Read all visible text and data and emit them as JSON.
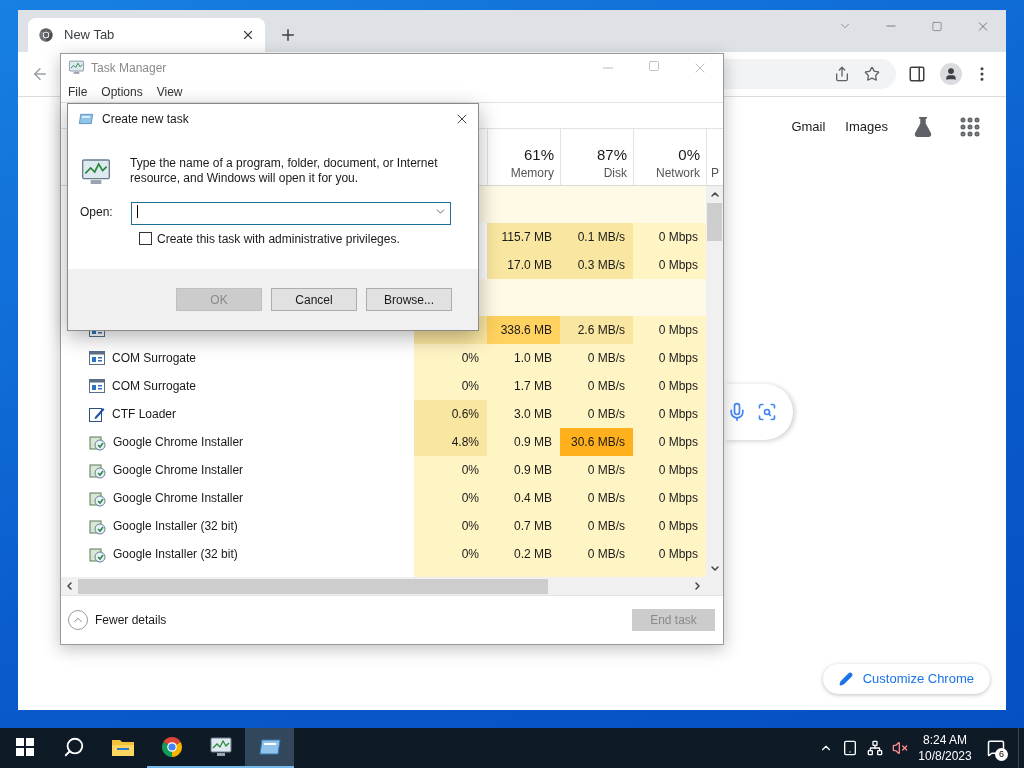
{
  "chrome": {
    "tabs": [
      {
        "title": "New Tab",
        "selected": true
      }
    ],
    "header_links": [
      "Gmail",
      "Images"
    ],
    "customize_button": "Customize Chrome"
  },
  "task_manager": {
    "title": "Task Manager",
    "menu": [
      "File",
      "Options",
      "View"
    ],
    "columns": [
      {
        "percent": "61%",
        "label": "Memory"
      },
      {
        "percent": "87%",
        "label": "Disk"
      },
      {
        "percent": "0%",
        "label": "Network"
      },
      {
        "label": "P"
      }
    ],
    "rows": [
      {
        "kind": "group"
      },
      {
        "kind": "hidden",
        "cells": [
          null,
          {
            "text": "115.7 MB",
            "color": "#f9e6a0"
          },
          {
            "text": "0.1 MB/s",
            "color": "#f9e6a0"
          },
          {
            "text": "0 Mbps",
            "color": "#fff4c4"
          }
        ]
      },
      {
        "kind": "hidden",
        "cells": [
          null,
          {
            "text": "17.0 MB",
            "color": "#f9e6a0"
          },
          {
            "text": "0.3 MB/s",
            "color": "#f9e6a0"
          },
          {
            "text": "0 Mbps",
            "color": "#fff4c4"
          }
        ]
      },
      {
        "kind": "group"
      },
      {
        "kind": "service",
        "cells": [
          {
            "color": "#f9e6a0"
          },
          {
            "text": "338.6 MB",
            "color": "#ffd15e"
          },
          {
            "text": "2.6 MB/s",
            "color": "#f9e6a0"
          },
          {
            "text": "0 Mbps",
            "color": "#fff4c4"
          }
        ]
      },
      {
        "kind": "service",
        "name": "COM Surrogate",
        "cells": [
          {
            "text": "0%",
            "color": "#fff4c4"
          },
          {
            "text": "1.0 MB",
            "color": "#fff4c4"
          },
          {
            "text": "0 MB/s",
            "color": "#fff4c4"
          },
          {
            "text": "0 Mbps",
            "color": "#fff4c4"
          }
        ]
      },
      {
        "kind": "service",
        "name": "COM Surrogate",
        "cells": [
          {
            "text": "0%",
            "color": "#fff4c4"
          },
          {
            "text": "1.7 MB",
            "color": "#fff4c4"
          },
          {
            "text": "0 MB/s",
            "color": "#fff4c4"
          },
          {
            "text": "0 Mbps",
            "color": "#fff4c4"
          }
        ]
      },
      {
        "kind": "editor",
        "name": "CTF Loader",
        "cells": [
          {
            "text": "0.6%",
            "color": "#f9e6a0"
          },
          {
            "text": "3.0 MB",
            "color": "#fff4c4"
          },
          {
            "text": "0 MB/s",
            "color": "#fff4c4"
          },
          {
            "text": "0 Mbps",
            "color": "#fff4c4"
          }
        ]
      },
      {
        "kind": "installer",
        "name": "Google Chrome Installer",
        "cells": [
          {
            "text": "4.8%",
            "color": "#f9e6a0"
          },
          {
            "text": "0.9 MB",
            "color": "#fff4c4"
          },
          {
            "text": "30.6 MB/s",
            "color": "#ffb01c"
          },
          {
            "text": "0 Mbps",
            "color": "#fff4c4"
          }
        ]
      },
      {
        "kind": "installer",
        "name": "Google Chrome Installer",
        "cells": [
          {
            "text": "0%",
            "color": "#fff4c4"
          },
          {
            "text": "0.9 MB",
            "color": "#fff4c4"
          },
          {
            "text": "0 MB/s",
            "color": "#fff4c4"
          },
          {
            "text": "0 Mbps",
            "color": "#fff4c4"
          }
        ]
      },
      {
        "kind": "installer",
        "name": "Google Chrome Installer",
        "cells": [
          {
            "text": "0%",
            "color": "#fff4c4"
          },
          {
            "text": "0.4 MB",
            "color": "#fff4c4"
          },
          {
            "text": "0 MB/s",
            "color": "#fff4c4"
          },
          {
            "text": "0 Mbps",
            "color": "#fff4c4"
          }
        ]
      },
      {
        "kind": "installer",
        "name": "Google Installer (32 bit)",
        "cells": [
          {
            "text": "0%",
            "color": "#fff4c4"
          },
          {
            "text": "0.7 MB",
            "color": "#fff4c4"
          },
          {
            "text": "0 MB/s",
            "color": "#fff4c4"
          },
          {
            "text": "0 Mbps",
            "color": "#fff4c4"
          }
        ]
      },
      {
        "kind": "installer",
        "name": "Google Installer (32 bit)",
        "cells": [
          {
            "text": "0%",
            "color": "#fff4c4"
          },
          {
            "text": "0.2 MB",
            "color": "#fff4c4"
          },
          {
            "text": "0 MB/s",
            "color": "#fff4c4"
          },
          {
            "text": "0 Mbps",
            "color": "#fff4c4"
          }
        ]
      }
    ],
    "fewer_details": "Fewer details",
    "end_task": {
      "label": "End task",
      "disabled": true
    }
  },
  "dialog": {
    "title": "Create new task",
    "message": "Type the name of a program, folder, document, or Internet resource, and Windows will open it for you.",
    "open_label": "Open:",
    "admin_checkbox": {
      "label": "Create this task with administrative privileges.",
      "checked": false
    },
    "buttons": [
      {
        "label": "OK",
        "disabled": true
      },
      {
        "label": "Cancel",
        "disabled": false
      },
      {
        "label": "Browse...",
        "disabled": false
      }
    ]
  },
  "taskbar": {
    "apps": [
      {
        "kind": "start",
        "running": false,
        "active": false
      },
      {
        "kind": "search",
        "running": false,
        "active": false
      },
      {
        "kind": "explorer",
        "running": false,
        "active": false
      },
      {
        "kind": "chrome",
        "running": true,
        "active": false
      },
      {
        "kind": "taskmgr",
        "running": true,
        "active": false
      },
      {
        "kind": "run",
        "running": true,
        "active": true
      }
    ],
    "time": "8:24 AM",
    "date": "10/8/2023",
    "notifications": "6"
  }
}
